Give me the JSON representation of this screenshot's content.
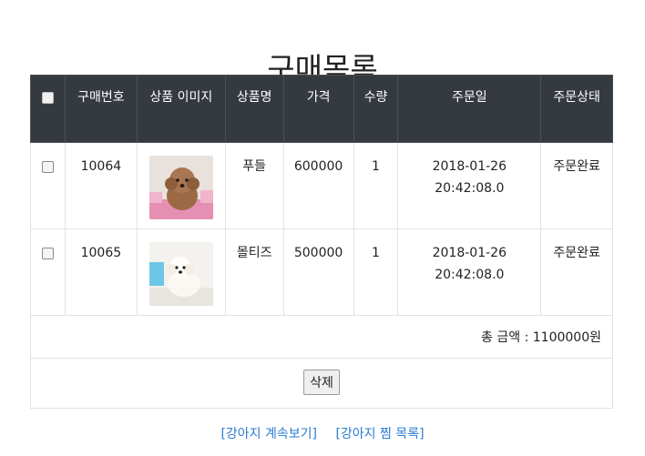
{
  "page": {
    "title": "구매목록"
  },
  "table": {
    "headers": {
      "order_no": "구매번호",
      "image": "상품 이미지",
      "name": "상품명",
      "price": "가격",
      "qty": "수량",
      "date": "주문일",
      "status": "주문상태"
    },
    "rows": [
      {
        "order_no": "10064",
        "image": "brown-poodle-puppy-photo",
        "name": "푸들",
        "price": "600000",
        "qty": "1",
        "date": "2018-01-26 20:42:08.0",
        "status": "주문완료",
        "checked": false
      },
      {
        "order_no": "10065",
        "image": "white-maltese-puppy-photo",
        "name": "몰티즈",
        "price": "500000",
        "qty": "1",
        "date": "2018-01-26 20:42:08.0",
        "status": "주문완료",
        "checked": false
      }
    ],
    "total": "총 금액 : 1100000원",
    "delete_label": "삭제"
  },
  "links": {
    "continue": "[강아지 계속보기]",
    "wishlist": "[강아지 찜 목록]"
  },
  "colors": {
    "header_bg": "#343a40",
    "link": "#2a7bd1"
  }
}
